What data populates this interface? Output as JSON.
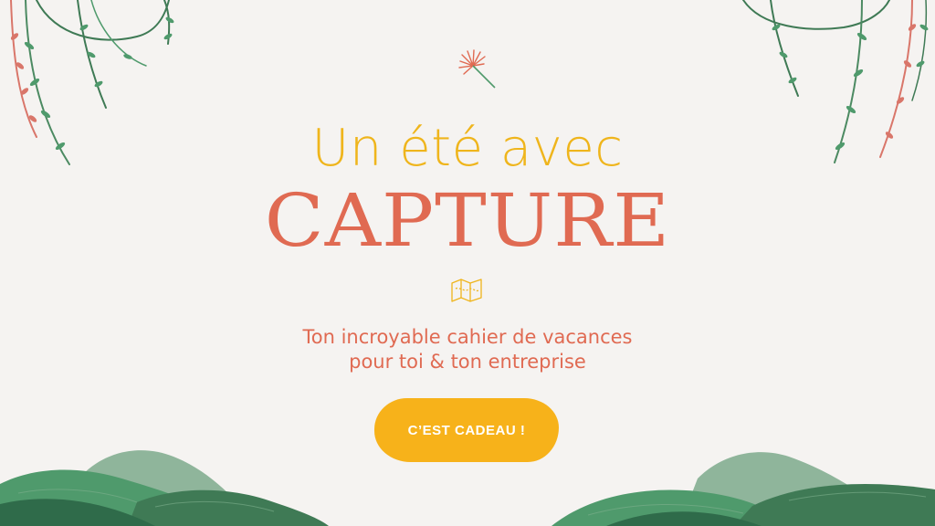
{
  "headline": {
    "line1": "Un été avec",
    "line2": "CAPTURE"
  },
  "subtitle": {
    "line1": "Ton incroyable cahier de vacances",
    "line2": "pour toi & ton entreprise"
  },
  "cta": {
    "label": "C’EST CADEAU !"
  },
  "colors": {
    "background": "#f5f3f1",
    "headline_yellow": "#efb51c",
    "accent_coral": "#e06a52",
    "button_yellow": "#f7b21a",
    "leaf_green": "#4f9a6c"
  },
  "decorations": [
    "hanging-vines-illustration",
    "dandelion-icon",
    "map-icon",
    "green-hills-illustration"
  ]
}
